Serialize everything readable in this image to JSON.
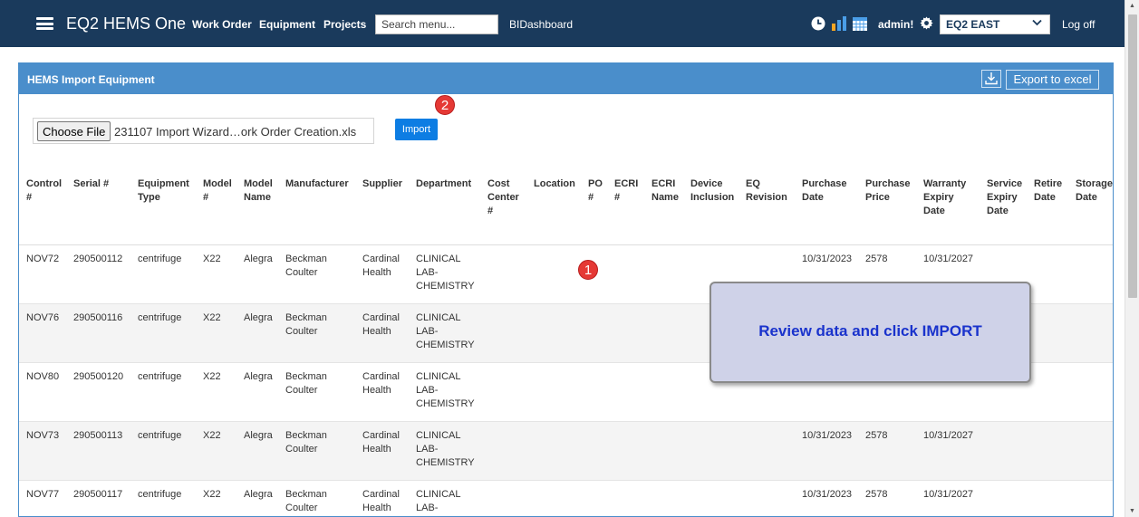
{
  "topbar": {
    "brand": "EQ2 HEMS One",
    "nav": [
      "Work Order",
      "Equipment",
      "Projects"
    ],
    "search_placeholder": "Search menu...",
    "bidashboard": "BIDashboard",
    "user": "admin!",
    "region": "EQ2 EAST",
    "logoff": "Log off",
    "icons": [
      "clock-icon",
      "bar-chart-icon",
      "calendar-icon",
      "gear-icon"
    ]
  },
  "panel": {
    "title": "HEMS Import Equipment",
    "export_label": "Export to excel",
    "choose_file_label": "Choose File",
    "file_name": "231107  Import Wizard…ork Order Creation.xls",
    "import_label": "Import"
  },
  "callouts": {
    "one": "1",
    "two": "2",
    "review": "Review data and click IMPORT"
  },
  "colors": {
    "nav_bg": "#1a3a5c",
    "panel_header": "#4a8ecb",
    "import_btn": "#0d7de3",
    "callout_red": "#e53935",
    "review_bg": "#cfd2e8",
    "review_text": "#1a33cc"
  },
  "table": {
    "columns": [
      "Control\n#",
      "Serial #",
      "Equipment\nType",
      "Model\n#",
      "Model\nName",
      "Manufacturer",
      "Supplier",
      "Department",
      "Cost\nCenter\n#",
      "Location",
      "PO\n#",
      "ECRI\n#",
      "ECRI\nName",
      "Device\nInclusion",
      "EQ\nRevision",
      "Purchase\nDate",
      "Purchase\nPrice",
      "Warranty\nExpiry\nDate",
      "Service\nExpiry\nDate",
      "Retire\nDate",
      "Storage\nDate"
    ],
    "rows": [
      [
        "NOV72",
        "290500112",
        "centrifuge",
        "X22",
        "Alegra",
        "Beckman\nCoulter",
        "Cardinal\nHealth",
        "CLINICAL\nLAB-\nCHEMISTRY",
        "",
        "",
        "",
        "",
        "",
        "",
        "",
        "10/31/2023",
        "2578",
        "10/31/2027",
        "",
        "",
        ""
      ],
      [
        "NOV76",
        "290500116",
        "centrifuge",
        "X22",
        "Alegra",
        "Beckman\nCoulter",
        "Cardinal\nHealth",
        "CLINICAL\nLAB-\nCHEMISTRY",
        "",
        "",
        "",
        "",
        "",
        "",
        "",
        "",
        "",
        "",
        "",
        "",
        ""
      ],
      [
        "NOV80",
        "290500120",
        "centrifuge",
        "X22",
        "Alegra",
        "Beckman\nCoulter",
        "Cardinal\nHealth",
        "CLINICAL\nLAB-\nCHEMISTRY",
        "",
        "",
        "",
        "",
        "",
        "",
        "",
        "",
        "",
        "",
        "",
        "",
        ""
      ],
      [
        "NOV73",
        "290500113",
        "centrifuge",
        "X22",
        "Alegra",
        "Beckman\nCoulter",
        "Cardinal\nHealth",
        "CLINICAL\nLAB-\nCHEMISTRY",
        "",
        "",
        "",
        "",
        "",
        "",
        "",
        "10/31/2023",
        "2578",
        "10/31/2027",
        "",
        "",
        ""
      ],
      [
        "NOV77",
        "290500117",
        "centrifuge",
        "X22",
        "Alegra",
        "Beckman\nCoulter",
        "Cardinal\nHealth",
        "CLINICAL\nLAB-",
        "",
        "",
        "",
        "",
        "",
        "",
        "",
        "10/31/2023",
        "2578",
        "10/31/2027",
        "",
        "",
        ""
      ]
    ]
  }
}
